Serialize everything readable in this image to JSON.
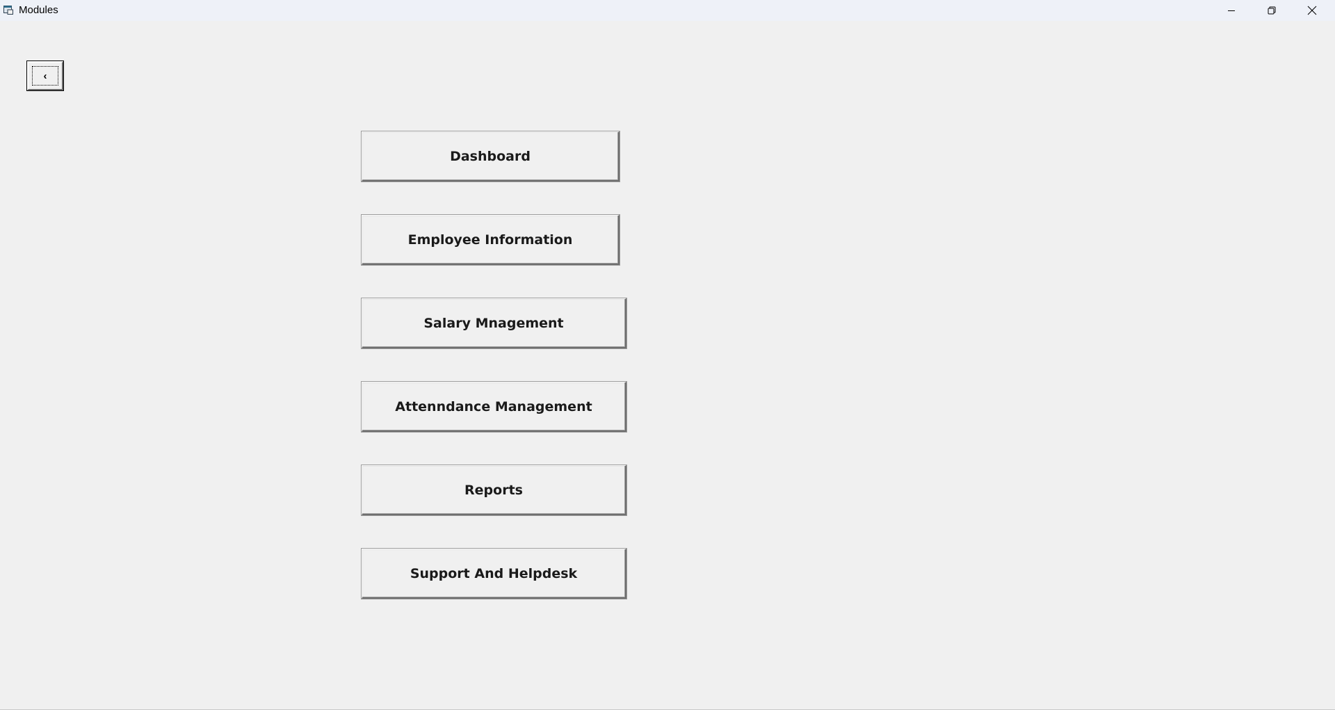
{
  "window": {
    "title": "Modules",
    "icons": {
      "app": "app-window-icon",
      "minimize": "minimize-icon",
      "restore": "restore-icon",
      "close": "close-icon"
    }
  },
  "toolbar": {
    "back_label": "‹"
  },
  "modules": [
    {
      "label": "Dashboard"
    },
    {
      "label": "Employee Information"
    },
    {
      "label": "Salary Mnagement"
    },
    {
      "label": "Attenndance Management"
    },
    {
      "label": "Reports"
    },
    {
      "label": "Support And Helpdesk"
    }
  ]
}
